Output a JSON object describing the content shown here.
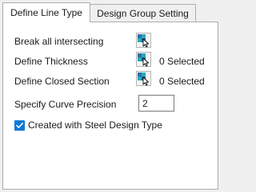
{
  "tabs": [
    {
      "label": "Define Line Type",
      "active": true
    },
    {
      "label": "Design Group Setting",
      "active": false
    }
  ],
  "rows": {
    "break_all": {
      "label": "Break all intersecting",
      "icon": "pick-elements-icon"
    },
    "thickness": {
      "label": "Define Thickness",
      "icon": "pick-elements-icon",
      "selected": "0 Selected"
    },
    "closed_section": {
      "label": "Define Closed Section",
      "icon": "pick-elements-icon",
      "selected": "0 Selected"
    }
  },
  "precision": {
    "label": "Specify Curve Precision",
    "value": "2"
  },
  "steel_design": {
    "label": "Created with Steel Design Type",
    "checked": true
  },
  "colors": {
    "accent": "#0a7ad4",
    "icon_blue": "#1f5a8a",
    "icon_teal": "#2aa9b8"
  }
}
